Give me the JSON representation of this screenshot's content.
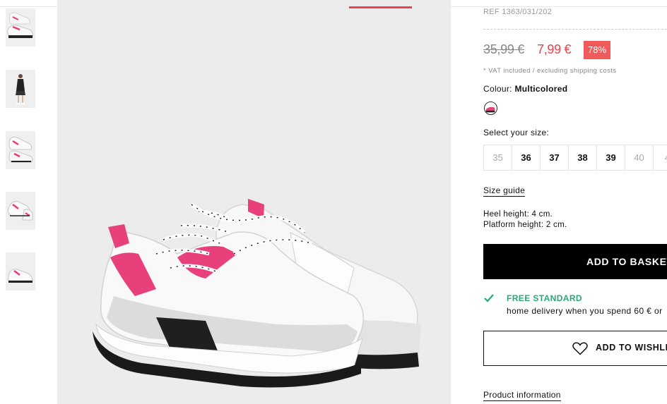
{
  "product": {
    "ref": "REF 1363/031/202",
    "old_price": "35,99 €",
    "new_price": "7,99 €",
    "discount": "78%",
    "vat_note": "* VAT included / excluding shipping costs",
    "colour_label": "Colour:",
    "colour_value": "Multicolored",
    "size_label": "Select your size:",
    "sizes": [
      {
        "label": "35",
        "available": false
      },
      {
        "label": "36",
        "available": true
      },
      {
        "label": "37",
        "available": true
      },
      {
        "label": "38",
        "available": true
      },
      {
        "label": "39",
        "available": true
      },
      {
        "label": "40",
        "available": false
      },
      {
        "label": "4",
        "available": false
      }
    ],
    "size_guide": "Size guide",
    "heel_height": "Heel height: 4 cm.",
    "platform_height": "Platform height: 2 cm.",
    "add_to_basket": "ADD TO BASKET",
    "free_standard": "FREE STANDARD",
    "home_delivery": "home delivery when you spend 60 € or",
    "add_to_wishlist": "ADD TO WISHLIST",
    "product_information": "Product information"
  },
  "icons": {
    "check": "check-icon",
    "heart": "heart-icon",
    "swatch": "colour-swatch"
  },
  "colors": {
    "accent": "#e8434f",
    "discount_bg": "#f05a5a",
    "shipping_green": "#2aa874",
    "basket_bg": "#000000"
  }
}
